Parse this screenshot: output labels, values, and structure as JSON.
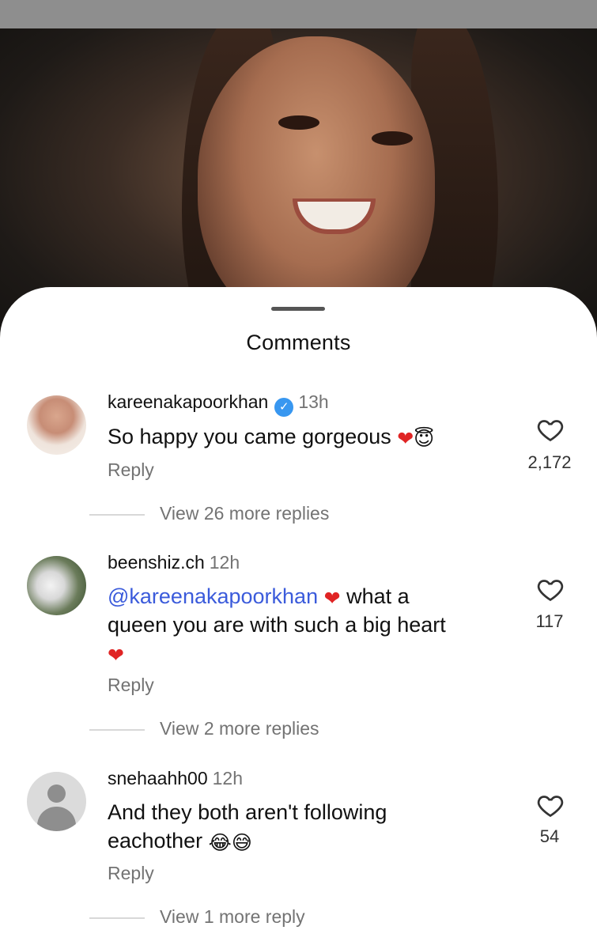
{
  "sheet": {
    "title": "Comments"
  },
  "comments": [
    {
      "username": "kareenakapoorkhan",
      "verified": true,
      "time": "13h",
      "text": "So happy you came gorgeous",
      "emojis": [
        "❤",
        "😇"
      ],
      "reply_label": "Reply",
      "likes": "2,172",
      "view_replies": "View 26 more replies"
    },
    {
      "username": "beenshiz.ch",
      "verified": false,
      "time": "12h",
      "mention": "@kareenakapoorkhan",
      "text_line1": "what a",
      "text_line2": "queen you are with such a big heart",
      "emojis": [
        "❤",
        "❤"
      ],
      "reply_label": "Reply",
      "likes": "117",
      "view_replies": "View 2 more replies"
    },
    {
      "username": "snehaahh00",
      "verified": false,
      "time": "12h",
      "text_line1": "And they both aren't following",
      "text_line2": "eachother",
      "emojis": [
        "😂",
        "😅"
      ],
      "reply_label": "Reply",
      "likes": "54",
      "view_replies": "View 1 more reply"
    }
  ]
}
